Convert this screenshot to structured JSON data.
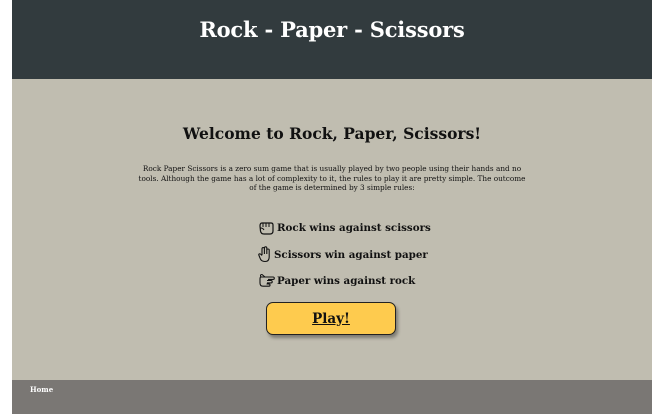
{
  "header": {
    "title": "Rock - Paper - Scissors"
  },
  "main": {
    "heading": "Welcome to Rock, Paper, Scissors!",
    "intro": "Rock Paper Scissors is a zero sum game that is usually played by two people using their hands and no tools. Although the game has a lot of complexity to it, the rules to play it are pretty simple. The outcome of the game is determined by 3 simple rules:",
    "rules": [
      {
        "icon": "hand-rock-icon",
        "text": "Rock wins against scissors"
      },
      {
        "icon": "hand-scissors-icon",
        "text": "Scissors win against paper"
      },
      {
        "icon": "hand-paper-icon",
        "text": "Paper wins against rock"
      }
    ],
    "play_label": "Play!"
  },
  "footer": {
    "home_label": "Home"
  },
  "colors": {
    "header_bg": "#323b3e",
    "body_bg": "#c0bdb0",
    "button_bg": "#fecb4e",
    "footer_bg": "#7a7774"
  }
}
